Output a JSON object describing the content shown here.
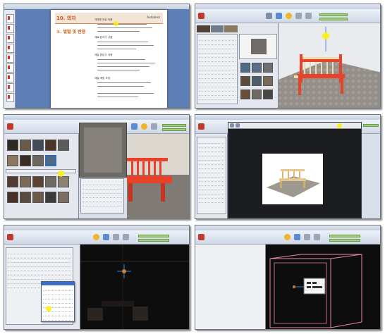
{
  "panel1": {
    "doc_heading": "10. 의자",
    "doc_subheading": "①. 벌벌 및 반응",
    "doc_logo": "Autodesk",
    "sections": [
      "객체에 재료 적용",
      "재료 탐색기 사용",
      "재질 편집기 사용",
      "재질 매핑 조정"
    ]
  },
  "panel3": {
    "cursor_label": "확인"
  },
  "colors": {
    "accent_highlight": "#fff200",
    "bench_red": "#e8432a",
    "scene_dark": "#0d0d0d",
    "doc_orange": "#c85a14",
    "ribbon_blue": "#cfd8e6"
  },
  "icons": [
    "app-menu-icon",
    "material-swatch-icon",
    "render-icon",
    "sun-icon",
    "lightbulb-icon",
    "cursor-icon"
  ]
}
